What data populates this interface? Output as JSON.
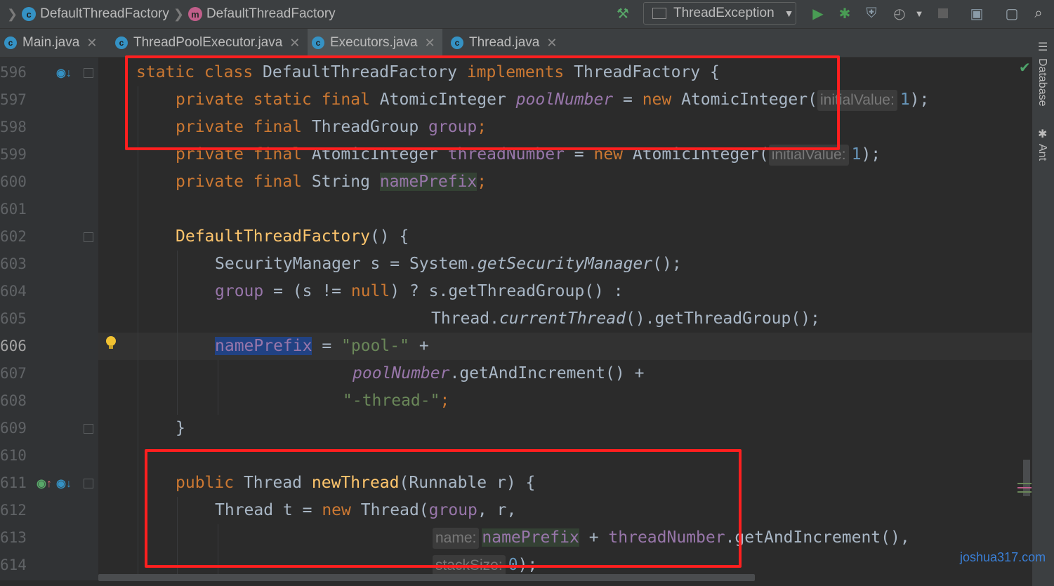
{
  "breadcrumb": {
    "class_name": "DefaultThreadFactory",
    "method_name": "DefaultThreadFactory"
  },
  "toolbar": {
    "run_config": "ThreadException"
  },
  "tabs": [
    {
      "label": "Main.java",
      "active": false
    },
    {
      "label": "ThreadPoolExecutor.java",
      "active": false
    },
    {
      "label": "Executors.java",
      "active": true
    },
    {
      "label": "Thread.java",
      "active": false
    }
  ],
  "line_numbers": [
    "596",
    "597",
    "598",
    "599",
    "600",
    "601",
    "602",
    "603",
    "604",
    "605",
    "606",
    "607",
    "608",
    "609",
    "610",
    "611",
    "612",
    "613",
    "614"
  ],
  "current_line": "606",
  "code": {
    "l596": {
      "a": "static class ",
      "b": "DefaultThreadFactory ",
      "c": "implements ",
      "d": "ThreadFactory {"
    },
    "l597": {
      "a": "private static final ",
      "b": "AtomicInteger ",
      "c": "poolNumber",
      " d": " = ",
      "e": "new ",
      "f": "AtomicInteger(",
      "hint": "initialValue:",
      "num": "1",
      "end": ");"
    },
    "l598": {
      "a": "private final ",
      "b": "ThreadGroup ",
      "c": "group",
      "d": ";"
    },
    "l599": {
      "a": "private final ",
      "b": "AtomicInteger ",
      "c": "threadNumber",
      "d": " = ",
      "e": "new ",
      "f": "AtomicInteger(",
      "hint": "initialValue:",
      "num": "1",
      "end": ");"
    },
    "l600": {
      "a": "private final ",
      "b": "String ",
      "c": "namePrefix",
      "d": ";"
    },
    "l602": {
      "a": "DefaultThreadFactory",
      "b": "() {"
    },
    "l603": {
      "a": "SecurityManager s = System.",
      "b": "getSecurityManager",
      "c": "();"
    },
    "l604": {
      "a": "group",
      "b": " = (s != ",
      "c": "null",
      "d": ") ? s.getThreadGroup() :"
    },
    "l605": {
      "a": "Thread.",
      "b": "currentThread",
      "c": "().getThreadGroup();"
    },
    "l606": {
      "a": "namePrefix",
      "b": " = ",
      "c": "\"pool-\"",
      "d": " +"
    },
    "l607": {
      "a": "poolNumber",
      "b": ".getAndIncrement() +"
    },
    "l608": {
      "a": "\"-thread-\"",
      "b": ";"
    },
    "l609": {
      "a": "}"
    },
    "l611": {
      "a": "public ",
      "b": "Thread ",
      "c": "newThread",
      "d": "(Runnable r) {"
    },
    "l612": {
      "a": "Thread t = ",
      "b": "new ",
      "c": "Thread(",
      "d": "group",
      "e": ", r,"
    },
    "l613": {
      "hint": "name:",
      "a": "namePrefix",
      "b": " + ",
      "c": "threadNumber",
      "d": ".getAndIncrement(),"
    },
    "l614": {
      "hint": "stackSize:",
      "num": "0",
      "end": ");"
    }
  },
  "right_panel": {
    "database_label": "Database",
    "ant_label": "Ant"
  },
  "watermark": "joshua317.com"
}
